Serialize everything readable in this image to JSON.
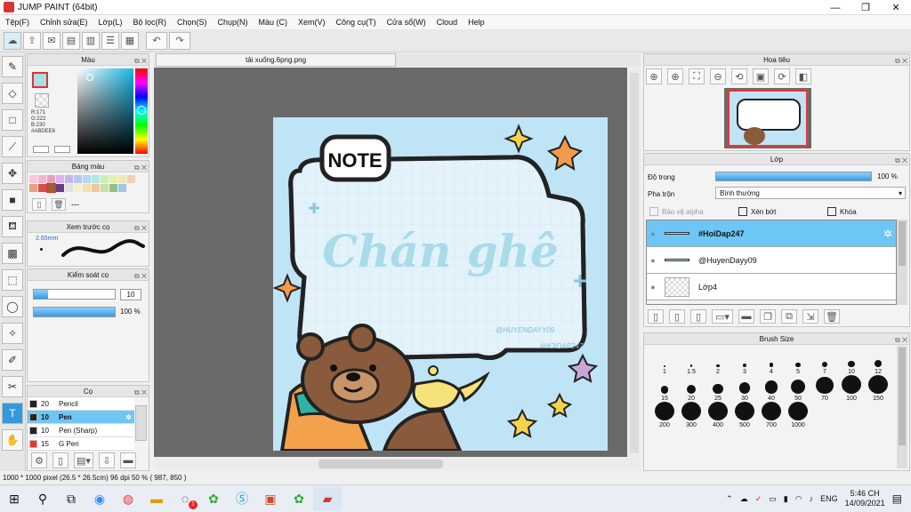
{
  "window": {
    "title": "JUMP PAINT (64bit)",
    "min": "—",
    "restore": "❐",
    "close": "✕"
  },
  "menu": [
    "Tệp(F)",
    "Chỉnh sửa(E)",
    "Lớp(L)",
    "Bộ lọc(R)",
    "Chọn(S)",
    "Chụp(N)",
    "Màu (C)",
    "Xem(V)",
    "Công cụ(T)",
    "Cửa sổ(W)",
    "Cloud",
    "Help"
  ],
  "color_panel": {
    "title": "Màu",
    "r": "R:171",
    "g": "G:222",
    "b": "B:230",
    "hex": "#ABDEE6"
  },
  "swatch_panel": {
    "title": "Bảng màu",
    "colors": [
      "#f7c8d8",
      "#f5b3c7",
      "#e79fbf",
      "#d9b3e8",
      "#c8b3f0",
      "#b3c8f0",
      "#b3d9f0",
      "#b3e8e0",
      "#c8f0b3",
      "#e0f0b3",
      "#f0e8b3",
      "#f0d0b3",
      "#e6a07a",
      "#d45050",
      "#a06030",
      "#6a3a8a",
      "#e0e0e0",
      "#f5f0c8",
      "#f5e0b0",
      "#f0c8a0",
      "#c8e0a0",
      "#90c090",
      "#a0c8e8"
    ],
    "dots": "---"
  },
  "brush_preview": {
    "title": "Xem trước cọ",
    "size": "2.65mm"
  },
  "brush_control": {
    "title": "Kiểm soát cọ",
    "size_value": "10",
    "opacity_value": "100 %"
  },
  "brush_panel": {
    "title": "Cọ",
    "items": [
      {
        "n": "20",
        "name": "Pencil",
        "color": "#222"
      },
      {
        "n": "10",
        "name": "Pen",
        "color": "#222"
      },
      {
        "n": "10",
        "name": "Pen (Sharp)",
        "color": "#222"
      },
      {
        "n": "15",
        "name": "G Pen",
        "color": "#e33"
      }
    ]
  },
  "document": {
    "tab": "tải xuống.6png.png",
    "note_label": "NOTE",
    "title_text": "Chán ghê",
    "watermark1": "@HUYENDAYY09",
    "watermark2": "#HOIDAP247"
  },
  "navigator": {
    "title": "Hoa tiêu"
  },
  "layer_panel": {
    "title": "Lớp",
    "opacity_label": "Độ trong",
    "opacity_value": "100 %",
    "blend_label": "Pha trộn",
    "blend_value": "Bình thường",
    "protect_alpha": "Bảo vệ alpha",
    "clipping": "Xén bớt",
    "lock": "Khóa",
    "layers": [
      {
        "name": "#HoiDap247"
      },
      {
        "name": "@HuyenDayy09"
      },
      {
        "name": "Lớp4"
      }
    ]
  },
  "brush_size": {
    "title": "Brush Size",
    "sizes": [
      "1",
      "1.5",
      "2",
      "3",
      "4",
      "5",
      "7",
      "10",
      "12",
      "15",
      "20",
      "25",
      "30",
      "40",
      "50",
      "70",
      "100",
      "150",
      "200",
      "300",
      "400",
      "500",
      "700",
      "1000"
    ]
  },
  "status": {
    "text": "1000 * 1000 pixel   (26.5 * 26.5cm)   96 dpi   50 %   ( 987, 850 )"
  },
  "taskbar": {
    "lang": "ENG",
    "time": "5:46 CH",
    "date": "14/09/2021",
    "badge": "1"
  }
}
